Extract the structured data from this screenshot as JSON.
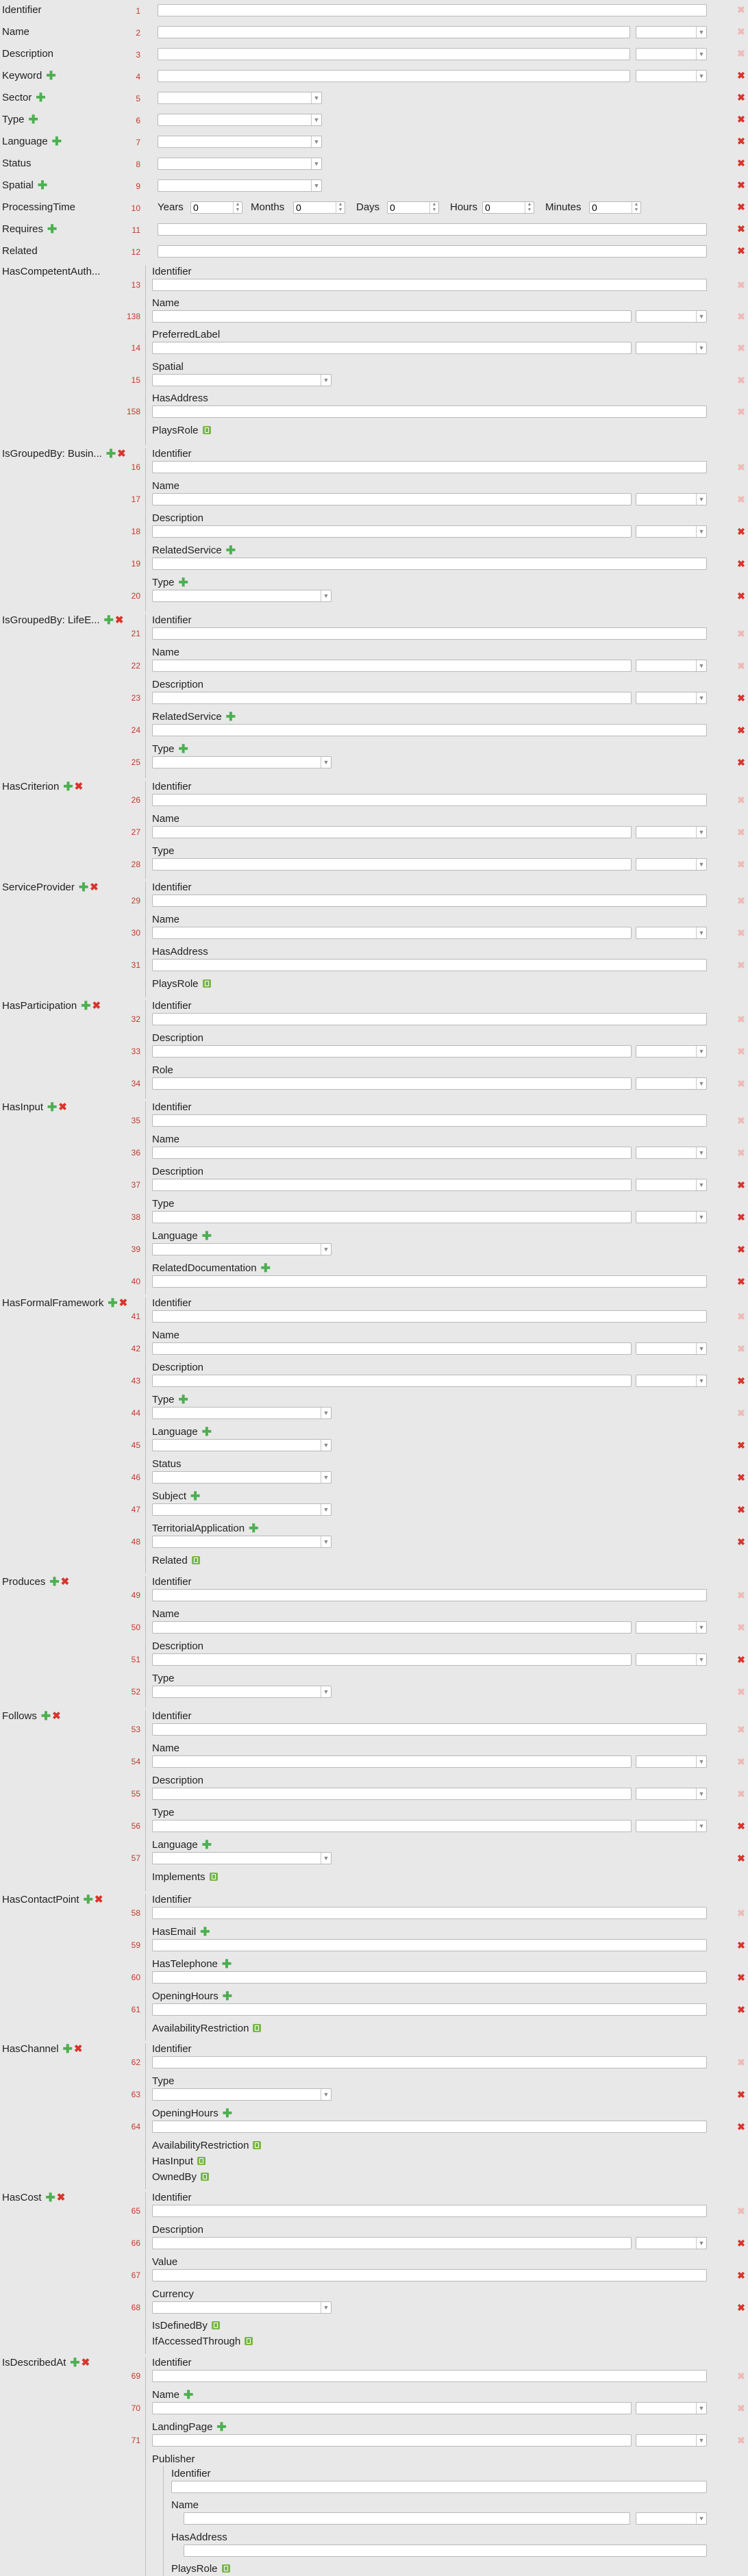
{
  "fields": [
    {
      "label": "Identifier",
      "num": "1"
    },
    {
      "label": "Name",
      "num": "2"
    },
    {
      "label": "Description",
      "num": "3"
    },
    {
      "label": "Keyword",
      "num": "4"
    },
    {
      "label": "Sector",
      "num": "5"
    },
    {
      "label": "Type",
      "num": "6"
    },
    {
      "label": "Language",
      "num": "7"
    },
    {
      "label": "Status",
      "num": "8"
    },
    {
      "label": "Spatial",
      "num": "9"
    },
    {
      "label": "ProcessingTime",
      "num": "10"
    },
    {
      "label": "Requires",
      "num": "11"
    },
    {
      "label": "Related",
      "num": "12"
    }
  ],
  "processing_time": {
    "years_label": "Years",
    "years": "0",
    "months_label": "Months",
    "months": "0",
    "days_label": "Days",
    "days": "0",
    "hours_label": "Hours",
    "hours": "0",
    "minutes_label": "Minutes",
    "minutes": "0"
  },
  "groups": [
    {
      "label": "HasCompetentAuth...",
      "subs": [
        {
          "label": "Identifier",
          "num": "13"
        },
        {
          "label": "Name",
          "num": "138"
        },
        {
          "label": "PreferredLabel",
          "num": "14"
        },
        {
          "label": "Spatial",
          "num": "15"
        },
        {
          "label": "HasAddress",
          "num": "158"
        },
        {
          "label": "PlaysRole"
        }
      ]
    },
    {
      "label": "IsGroupedBy: Busin...",
      "subs": [
        {
          "label": "Identifier",
          "num": "16"
        },
        {
          "label": "Name",
          "num": "17"
        },
        {
          "label": "Description",
          "num": "18"
        },
        {
          "label": "RelatedService",
          "num": "19"
        },
        {
          "label": "Type",
          "num": "20"
        }
      ]
    },
    {
      "label": "IsGroupedBy: LifeE...",
      "subs": [
        {
          "label": "Identifier",
          "num": "21"
        },
        {
          "label": "Name",
          "num": "22"
        },
        {
          "label": "Description",
          "num": "23"
        },
        {
          "label": "RelatedService",
          "num": "24"
        },
        {
          "label": "Type",
          "num": "25"
        }
      ]
    },
    {
      "label": "HasCriterion",
      "subs": [
        {
          "label": "Identifier",
          "num": "26"
        },
        {
          "label": "Name",
          "num": "27"
        },
        {
          "label": "Type",
          "num": "28"
        }
      ]
    },
    {
      "label": "ServiceProvider",
      "subs": [
        {
          "label": "Identifier",
          "num": "29"
        },
        {
          "label": "Name",
          "num": "30"
        },
        {
          "label": "HasAddress",
          "num": "31"
        },
        {
          "label": "PlaysRole"
        }
      ]
    },
    {
      "label": "HasParticipation",
      "subs": [
        {
          "label": "Identifier",
          "num": "32"
        },
        {
          "label": "Description",
          "num": "33"
        },
        {
          "label": "Role",
          "num": "34"
        }
      ]
    },
    {
      "label": "HasInput",
      "subs": [
        {
          "label": "Identifier",
          "num": "35"
        },
        {
          "label": "Name",
          "num": "36"
        },
        {
          "label": "Description",
          "num": "37"
        },
        {
          "label": "Type",
          "num": "38"
        },
        {
          "label": "Language",
          "num": "39"
        },
        {
          "label": "RelatedDocumentation",
          "num": "40"
        }
      ]
    },
    {
      "label": "HasFormalFramework",
      "subs": [
        {
          "label": "Identifier",
          "num": "41"
        },
        {
          "label": "Name",
          "num": "42"
        },
        {
          "label": "Description",
          "num": "43"
        },
        {
          "label": "Type",
          "num": "44"
        },
        {
          "label": "Language",
          "num": "45"
        },
        {
          "label": "Status",
          "num": "46"
        },
        {
          "label": "Subject",
          "num": "47"
        },
        {
          "label": "TerritorialApplication",
          "num": "48"
        },
        {
          "label": "Related"
        }
      ]
    },
    {
      "label": "Produces",
      "subs": [
        {
          "label": "Identifier",
          "num": "49"
        },
        {
          "label": "Name",
          "num": "50"
        },
        {
          "label": "Description",
          "num": "51"
        },
        {
          "label": "Type",
          "num": "52"
        }
      ]
    },
    {
      "label": "Follows",
      "subs": [
        {
          "label": "Identifier",
          "num": "53"
        },
        {
          "label": "Name",
          "num": "54"
        },
        {
          "label": "Description",
          "num": "55"
        },
        {
          "label": "Type",
          "num": "56"
        },
        {
          "label": "Language",
          "num": "57"
        },
        {
          "label": "Implements"
        }
      ]
    },
    {
      "label": "HasContactPoint",
      "subs": [
        {
          "label": "Identifier",
          "num": "58"
        },
        {
          "label": "HasEmail",
          "num": "59"
        },
        {
          "label": "HasTelephone",
          "num": "60"
        },
        {
          "label": "OpeningHours",
          "num": "61"
        },
        {
          "label": "AvailabilityRestriction"
        }
      ]
    },
    {
      "label": "HasChannel",
      "subs": [
        {
          "label": "Identifier",
          "num": "62"
        },
        {
          "label": "Type",
          "num": "63"
        },
        {
          "label": "OpeningHours",
          "num": "64"
        },
        {
          "label": "AvailabilityRestriction"
        },
        {
          "label": "HasInput"
        },
        {
          "label": "OwnedBy"
        }
      ]
    },
    {
      "label": "HasCost",
      "subs": [
        {
          "label": "Identifier",
          "num": "65"
        },
        {
          "label": "Description",
          "num": "66"
        },
        {
          "label": "Value",
          "num": "67"
        },
        {
          "label": "Currency",
          "num": "68"
        },
        {
          "label": "IsDefinedBy"
        },
        {
          "label": "IfAccessedThrough"
        }
      ]
    },
    {
      "label": "IsDescribedAt",
      "subs": [
        {
          "label": "Identifier",
          "num": "69"
        },
        {
          "label": "Name",
          "num": "70"
        },
        {
          "label": "LandingPage",
          "num": "71"
        },
        {
          "label": "Publisher"
        }
      ]
    }
  ],
  "publisher": [
    {
      "label": "Identifier"
    },
    {
      "label": "Name"
    },
    {
      "label": "HasAddress"
    },
    {
      "label": "PlaysRole"
    }
  ],
  "icons": {
    "add": "plus-icon",
    "remove": "remove-icon",
    "reference": "reference-icon",
    "dropdown": "chevron-down-icon"
  },
  "colors": {
    "number": "#c0392b",
    "remove": "#d9342b",
    "add": "#4caf50",
    "reference": "#7ab648"
  }
}
